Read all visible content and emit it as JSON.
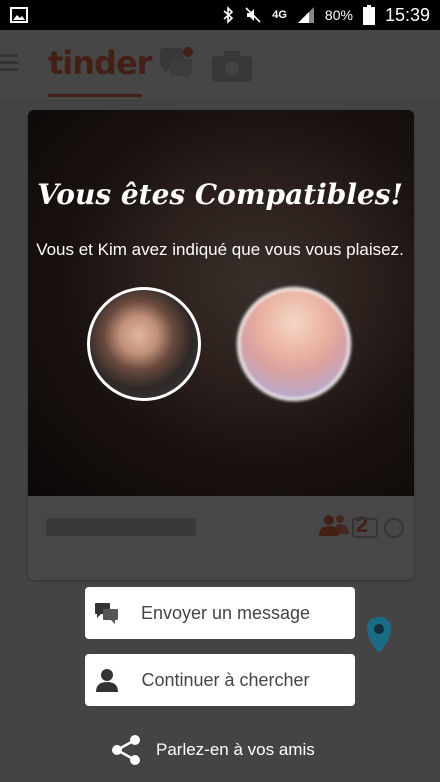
{
  "status_bar": {
    "network": "4G",
    "battery": "80%",
    "time": "15:39"
  },
  "app": {
    "logo": "tinder",
    "friends_count": "2"
  },
  "match": {
    "title": "Vous êtes Compatibles!",
    "subtitle": "Vous et Kim avez indiqué que vous vous plaisez."
  },
  "actions": {
    "send_message": "Envoyer un message",
    "keep_swiping": "Continuer à chercher",
    "share": "Parlez-en à vos amis"
  },
  "colors": {
    "brand": "#f07050",
    "overlay": "#000000",
    "button_bg": "#ffffff"
  },
  "icons": [
    "gallery-icon",
    "bluetooth-icon",
    "mute-icon",
    "signal-icon",
    "battery-icon",
    "chat-icon",
    "person-icon",
    "share-icon",
    "map-pin-icon"
  ]
}
